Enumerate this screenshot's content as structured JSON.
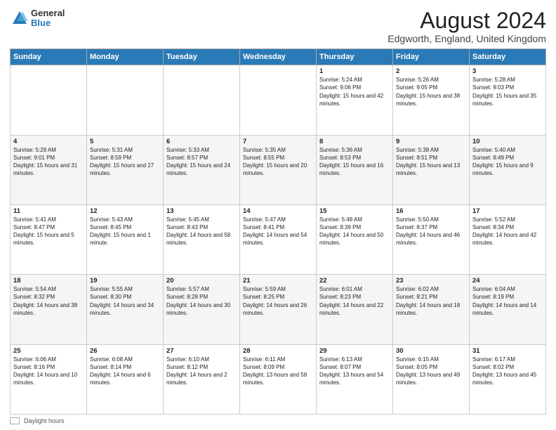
{
  "logo": {
    "general": "General",
    "blue": "Blue"
  },
  "title": "August 2024",
  "subtitle": "Edgworth, England, United Kingdom",
  "headers": [
    "Sunday",
    "Monday",
    "Tuesday",
    "Wednesday",
    "Thursday",
    "Friday",
    "Saturday"
  ],
  "footer": {
    "label": "Daylight hours"
  },
  "weeks": [
    [
      {
        "day": "",
        "sunrise": "",
        "sunset": "",
        "daylight": ""
      },
      {
        "day": "",
        "sunrise": "",
        "sunset": "",
        "daylight": ""
      },
      {
        "day": "",
        "sunrise": "",
        "sunset": "",
        "daylight": ""
      },
      {
        "day": "",
        "sunrise": "",
        "sunset": "",
        "daylight": ""
      },
      {
        "day": "1",
        "sunrise": "Sunrise: 5:24 AM",
        "sunset": "Sunset: 9:06 PM",
        "daylight": "Daylight: 15 hours and 42 minutes."
      },
      {
        "day": "2",
        "sunrise": "Sunrise: 5:26 AM",
        "sunset": "Sunset: 9:05 PM",
        "daylight": "Daylight: 15 hours and 38 minutes."
      },
      {
        "day": "3",
        "sunrise": "Sunrise: 5:28 AM",
        "sunset": "Sunset: 9:03 PM",
        "daylight": "Daylight: 15 hours and 35 minutes."
      }
    ],
    [
      {
        "day": "4",
        "sunrise": "Sunrise: 5:29 AM",
        "sunset": "Sunset: 9:01 PM",
        "daylight": "Daylight: 15 hours and 31 minutes."
      },
      {
        "day": "5",
        "sunrise": "Sunrise: 5:31 AM",
        "sunset": "Sunset: 8:59 PM",
        "daylight": "Daylight: 15 hours and 27 minutes."
      },
      {
        "day": "6",
        "sunrise": "Sunrise: 5:33 AM",
        "sunset": "Sunset: 8:57 PM",
        "daylight": "Daylight: 15 hours and 24 minutes."
      },
      {
        "day": "7",
        "sunrise": "Sunrise: 5:35 AM",
        "sunset": "Sunset: 8:55 PM",
        "daylight": "Daylight: 15 hours and 20 minutes."
      },
      {
        "day": "8",
        "sunrise": "Sunrise: 5:36 AM",
        "sunset": "Sunset: 8:53 PM",
        "daylight": "Daylight: 15 hours and 16 minutes."
      },
      {
        "day": "9",
        "sunrise": "Sunrise: 5:38 AM",
        "sunset": "Sunset: 8:51 PM",
        "daylight": "Daylight: 15 hours and 13 minutes."
      },
      {
        "day": "10",
        "sunrise": "Sunrise: 5:40 AM",
        "sunset": "Sunset: 8:49 PM",
        "daylight": "Daylight: 15 hours and 9 minutes."
      }
    ],
    [
      {
        "day": "11",
        "sunrise": "Sunrise: 5:41 AM",
        "sunset": "Sunset: 8:47 PM",
        "daylight": "Daylight: 15 hours and 5 minutes."
      },
      {
        "day": "12",
        "sunrise": "Sunrise: 5:43 AM",
        "sunset": "Sunset: 8:45 PM",
        "daylight": "Daylight: 15 hours and 1 minute."
      },
      {
        "day": "13",
        "sunrise": "Sunrise: 5:45 AM",
        "sunset": "Sunset: 8:43 PM",
        "daylight": "Daylight: 14 hours and 58 minutes."
      },
      {
        "day": "14",
        "sunrise": "Sunrise: 5:47 AM",
        "sunset": "Sunset: 8:41 PM",
        "daylight": "Daylight: 14 hours and 54 minutes."
      },
      {
        "day": "15",
        "sunrise": "Sunrise: 5:48 AM",
        "sunset": "Sunset: 8:39 PM",
        "daylight": "Daylight: 14 hours and 50 minutes."
      },
      {
        "day": "16",
        "sunrise": "Sunrise: 5:50 AM",
        "sunset": "Sunset: 8:37 PM",
        "daylight": "Daylight: 14 hours and 46 minutes."
      },
      {
        "day": "17",
        "sunrise": "Sunrise: 5:52 AM",
        "sunset": "Sunset: 8:34 PM",
        "daylight": "Daylight: 14 hours and 42 minutes."
      }
    ],
    [
      {
        "day": "18",
        "sunrise": "Sunrise: 5:54 AM",
        "sunset": "Sunset: 8:32 PM",
        "daylight": "Daylight: 14 hours and 38 minutes."
      },
      {
        "day": "19",
        "sunrise": "Sunrise: 5:55 AM",
        "sunset": "Sunset: 8:30 PM",
        "daylight": "Daylight: 14 hours and 34 minutes."
      },
      {
        "day": "20",
        "sunrise": "Sunrise: 5:57 AM",
        "sunset": "Sunset: 8:28 PM",
        "daylight": "Daylight: 14 hours and 30 minutes."
      },
      {
        "day": "21",
        "sunrise": "Sunrise: 5:59 AM",
        "sunset": "Sunset: 8:25 PM",
        "daylight": "Daylight: 14 hours and 26 minutes."
      },
      {
        "day": "22",
        "sunrise": "Sunrise: 6:01 AM",
        "sunset": "Sunset: 8:23 PM",
        "daylight": "Daylight: 14 hours and 22 minutes."
      },
      {
        "day": "23",
        "sunrise": "Sunrise: 6:02 AM",
        "sunset": "Sunset: 8:21 PM",
        "daylight": "Daylight: 14 hours and 18 minutes."
      },
      {
        "day": "24",
        "sunrise": "Sunrise: 6:04 AM",
        "sunset": "Sunset: 8:19 PM",
        "daylight": "Daylight: 14 hours and 14 minutes."
      }
    ],
    [
      {
        "day": "25",
        "sunrise": "Sunrise: 6:06 AM",
        "sunset": "Sunset: 8:16 PM",
        "daylight": "Daylight: 14 hours and 10 minutes."
      },
      {
        "day": "26",
        "sunrise": "Sunrise: 6:08 AM",
        "sunset": "Sunset: 8:14 PM",
        "daylight": "Daylight: 14 hours and 6 minutes."
      },
      {
        "day": "27",
        "sunrise": "Sunrise: 6:10 AM",
        "sunset": "Sunset: 8:12 PM",
        "daylight": "Daylight: 14 hours and 2 minutes."
      },
      {
        "day": "28",
        "sunrise": "Sunrise: 6:11 AM",
        "sunset": "Sunset: 8:09 PM",
        "daylight": "Daylight: 13 hours and 58 minutes."
      },
      {
        "day": "29",
        "sunrise": "Sunrise: 6:13 AM",
        "sunset": "Sunset: 8:07 PM",
        "daylight": "Daylight: 13 hours and 54 minutes."
      },
      {
        "day": "30",
        "sunrise": "Sunrise: 6:15 AM",
        "sunset": "Sunset: 8:05 PM",
        "daylight": "Daylight: 13 hours and 49 minutes."
      },
      {
        "day": "31",
        "sunrise": "Sunrise: 6:17 AM",
        "sunset": "Sunset: 8:02 PM",
        "daylight": "Daylight: 13 hours and 45 minutes."
      }
    ]
  ]
}
